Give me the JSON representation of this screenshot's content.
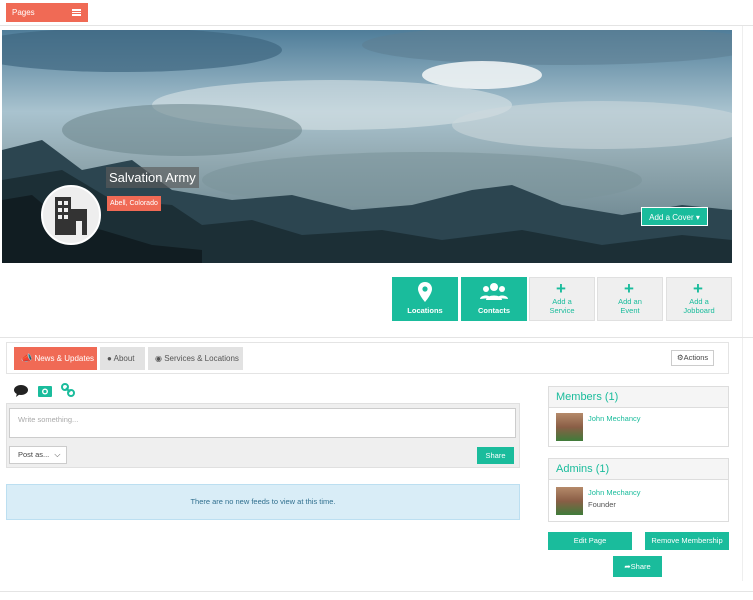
{
  "topbar": {
    "pages_label": "Pages"
  },
  "cover": {
    "org_name": "Salvation Army",
    "location": "Abell, Colorado",
    "add_cover_label": "Add a Cover ▾"
  },
  "tiles": [
    {
      "label": "Locations",
      "icon": "map-marker-icon",
      "style": "green"
    },
    {
      "label": "Contacts",
      "icon": "users-icon",
      "style": "green"
    },
    {
      "label_lines": [
        "Add a",
        "Service"
      ],
      "icon": "plus-icon",
      "style": "grey"
    },
    {
      "label_lines": [
        "Add an",
        "Event"
      ],
      "icon": "plus-icon",
      "style": "grey"
    },
    {
      "label_lines": [
        "Add a",
        "Jobboard"
      ],
      "icon": "plus-icon",
      "style": "grey"
    }
  ],
  "tabs": {
    "news": "News & Updates",
    "about": "About",
    "services": "Services & Locations",
    "actions": "Actions"
  },
  "composer": {
    "placeholder": "Write something...",
    "post_as": "Post as...",
    "share": "Share",
    "icons": [
      "comment-icon",
      "camera-icon",
      "link-icon"
    ]
  },
  "feed": {
    "empty_message": "There are no new feeds to view at this time."
  },
  "members": {
    "title": "Members (1)",
    "list": [
      {
        "name": "John Mechancy"
      }
    ]
  },
  "admins": {
    "title": "Admins (1)",
    "list": [
      {
        "name": "John Mechancy",
        "role": "Founder"
      }
    ]
  },
  "buttons": {
    "edit_page": "Edit Page",
    "remove_membership": "Remove Membership",
    "share": "Share"
  },
  "colors": {
    "accent": "#1abc9c",
    "brand": "#f06a55"
  }
}
